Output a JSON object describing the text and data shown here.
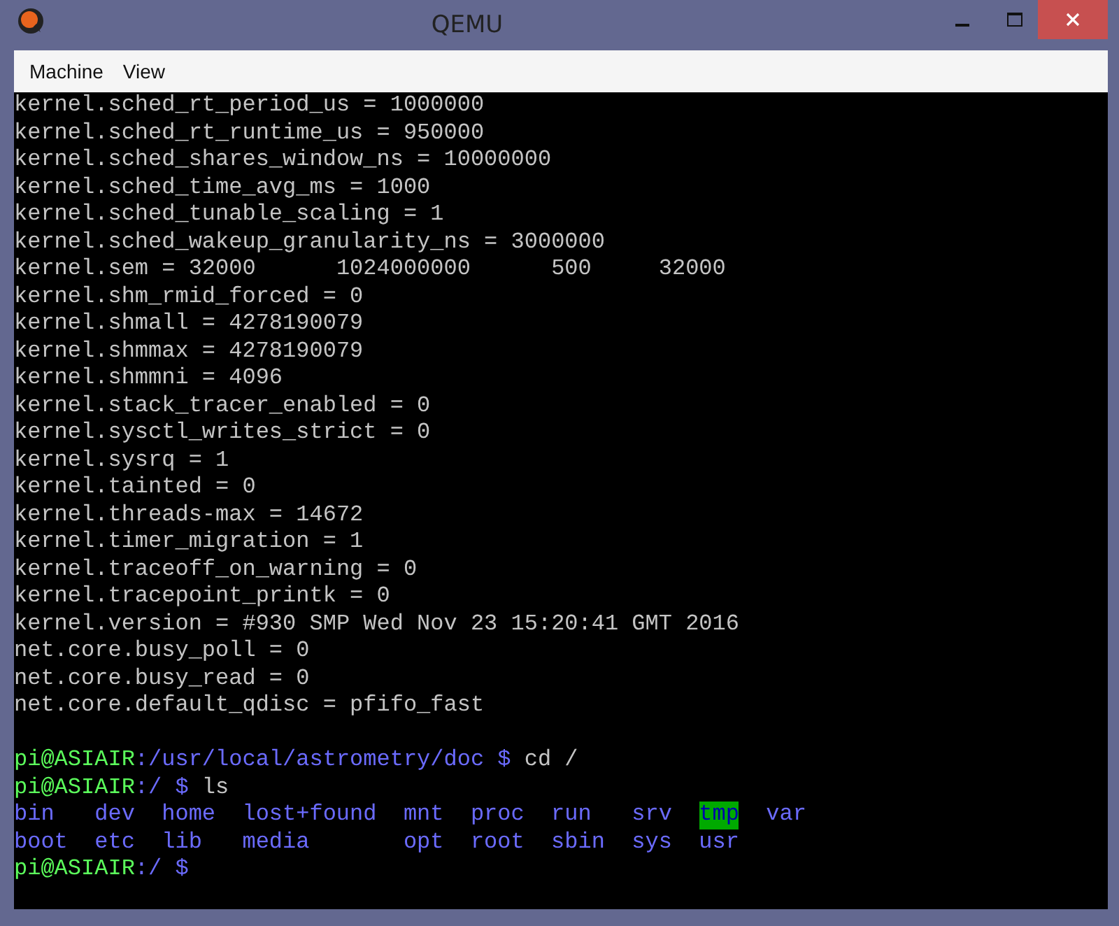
{
  "window": {
    "title": "QEMU"
  },
  "menu": [
    {
      "label": "Machine"
    },
    {
      "label": "View"
    }
  ],
  "terminal": {
    "lines": [
      {
        "kind": "text",
        "text": "kernel.sched_rt_period_us = 1000000"
      },
      {
        "kind": "text",
        "text": "kernel.sched_rt_runtime_us = 950000"
      },
      {
        "kind": "text",
        "text": "kernel.sched_shares_window_ns = 10000000"
      },
      {
        "kind": "text",
        "text": "kernel.sched_time_avg_ms = 1000"
      },
      {
        "kind": "text",
        "text": "kernel.sched_tunable_scaling = 1"
      },
      {
        "kind": "text",
        "text": "kernel.sched_wakeup_granularity_ns = 3000000"
      },
      {
        "kind": "text",
        "text": "kernel.sem = 32000      1024000000      500     32000"
      },
      {
        "kind": "text",
        "text": "kernel.shm_rmid_forced = 0"
      },
      {
        "kind": "text",
        "text": "kernel.shmall = 4278190079"
      },
      {
        "kind": "text",
        "text": "kernel.shmmax = 4278190079"
      },
      {
        "kind": "text",
        "text": "kernel.shmmni = 4096"
      },
      {
        "kind": "text",
        "text": "kernel.stack_tracer_enabled = 0"
      },
      {
        "kind": "text",
        "text": "kernel.sysctl_writes_strict = 0"
      },
      {
        "kind": "text",
        "text": "kernel.sysrq = 1"
      },
      {
        "kind": "text",
        "text": "kernel.tainted = 0"
      },
      {
        "kind": "text",
        "text": "kernel.threads-max = 14672"
      },
      {
        "kind": "text",
        "text": "kernel.timer_migration = 1"
      },
      {
        "kind": "text",
        "text": "kernel.traceoff_on_warning = 0"
      },
      {
        "kind": "text",
        "text": "kernel.tracepoint_printk = 0"
      },
      {
        "kind": "text",
        "text": "kernel.version = #930 SMP Wed Nov 23 15:20:41 GMT 2016"
      },
      {
        "kind": "text",
        "text": "net.core.busy_poll = 0"
      },
      {
        "kind": "text",
        "text": "net.core.busy_read = 0"
      },
      {
        "kind": "text",
        "text": "net.core.default_qdisc = pfifo_fast"
      },
      {
        "kind": "blank"
      },
      {
        "kind": "prompt",
        "user": "pi@ASIAIR",
        "path": ":/usr/local/astrometry/doc $",
        "command": "cd /"
      },
      {
        "kind": "prompt",
        "user": "pi@ASIAIR",
        "path": ":/ $",
        "command": "ls"
      },
      {
        "kind": "listing",
        "entries": [
          {
            "name": "bin",
            "highlighted": false
          },
          {
            "name": "dev",
            "highlighted": false
          },
          {
            "name": "home",
            "highlighted": false
          },
          {
            "name": "lost+found",
            "highlighted": false
          },
          {
            "name": "mnt",
            "highlighted": false
          },
          {
            "name": "proc",
            "highlighted": false
          },
          {
            "name": "run",
            "highlighted": false
          },
          {
            "name": "srv",
            "highlighted": false
          },
          {
            "name": "tmp",
            "highlighted": true
          },
          {
            "name": "var",
            "highlighted": false
          }
        ]
      },
      {
        "kind": "listing",
        "entries": [
          {
            "name": "boot",
            "highlighted": false
          },
          {
            "name": "etc",
            "highlighted": false
          },
          {
            "name": "lib",
            "highlighted": false
          },
          {
            "name": "media",
            "highlighted": false
          },
          {
            "name": "opt",
            "highlighted": false
          },
          {
            "name": "root",
            "highlighted": false
          },
          {
            "name": "sbin",
            "highlighted": false
          },
          {
            "name": "sys",
            "highlighted": false
          },
          {
            "name": "usr",
            "highlighted": false
          }
        ]
      },
      {
        "kind": "prompt",
        "user": "pi@ASIAIR",
        "path": ":/ $"
      }
    ]
  }
}
